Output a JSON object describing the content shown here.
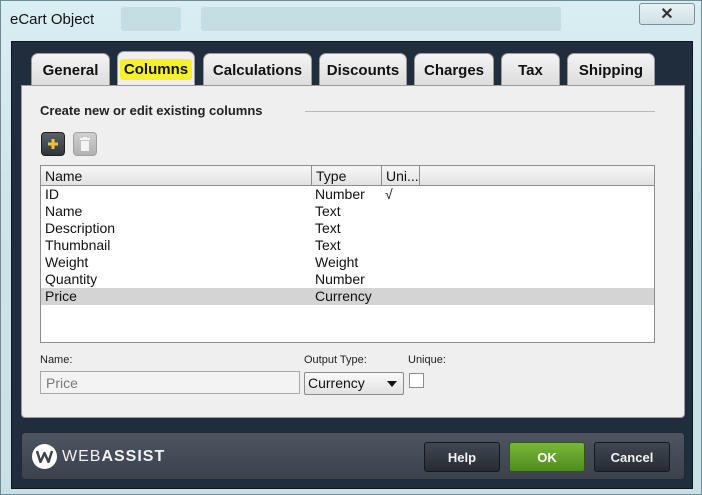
{
  "window": {
    "title": "eCart Object",
    "close_glyph": "✕"
  },
  "tabs": [
    {
      "label": "General"
    },
    {
      "label": "Columns"
    },
    {
      "label": "Calculations"
    },
    {
      "label": "Discounts"
    },
    {
      "label": "Charges"
    },
    {
      "label": "Tax"
    },
    {
      "label": "Shipping"
    }
  ],
  "active_tab": "Columns",
  "panel": {
    "section_title": "Create new or edit existing columns",
    "add_icon": "plus-icon",
    "delete_icon": "trash-icon"
  },
  "table": {
    "headers": [
      "Name",
      "Type",
      "Uni..."
    ],
    "rows": [
      {
        "name": "ID",
        "type": "Number",
        "unique": "√"
      },
      {
        "name": "Name",
        "type": "Text",
        "unique": ""
      },
      {
        "name": "Description",
        "type": "Text",
        "unique": ""
      },
      {
        "name": "Thumbnail",
        "type": "Text",
        "unique": ""
      },
      {
        "name": "Weight",
        "type": "Weight",
        "unique": ""
      },
      {
        "name": "Quantity",
        "type": "Number",
        "unique": ""
      },
      {
        "name": "Price",
        "type": "Currency",
        "unique": ""
      }
    ],
    "selected_row": "Price"
  },
  "fields": {
    "name_label": "Name:",
    "name_value": "Price",
    "output_type_label": "Output Type:",
    "output_type_value": "Currency",
    "unique_label": "Unique:",
    "unique_checked": false
  },
  "footer": {
    "logo_text_1": "WEB",
    "logo_text_2": "ASSIST",
    "help_label": "Help",
    "ok_label": "OK",
    "cancel_label": "Cancel"
  },
  "colors": {
    "frame": "#1f2d3d",
    "tab_highlight": "#f7f12a",
    "ok_green": "#5f9f27",
    "selected_row": "#d4d4d4"
  }
}
